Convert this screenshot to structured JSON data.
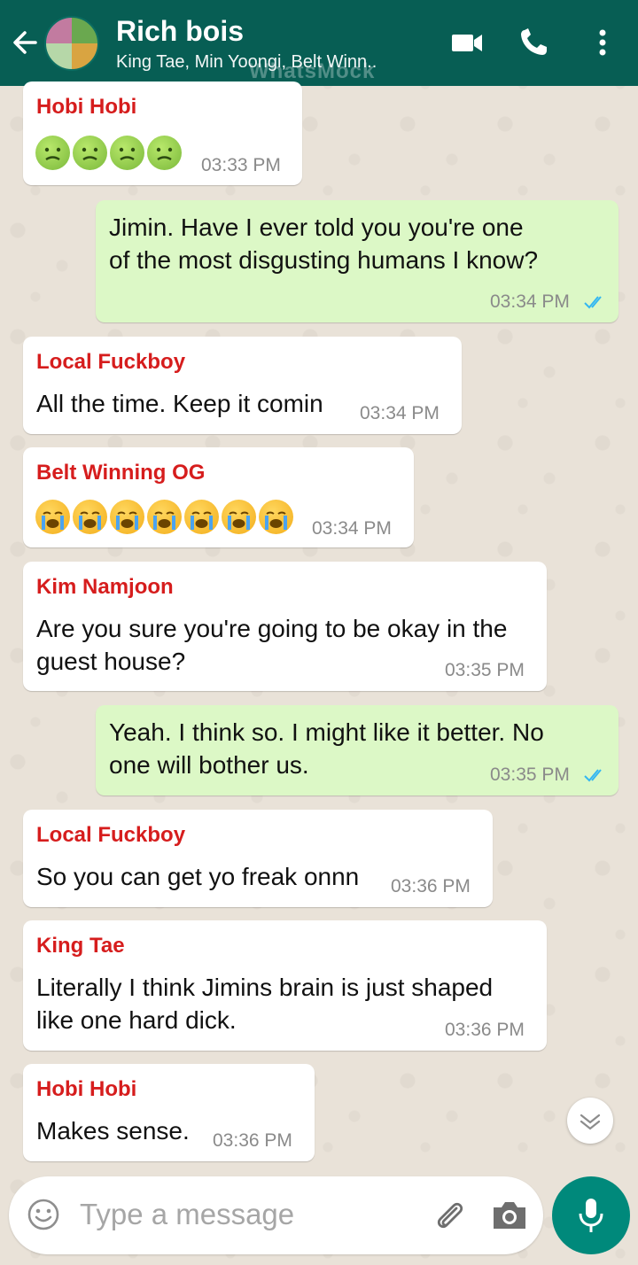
{
  "header": {
    "title": "Rich bois",
    "subtitle": "King Tae, Min Yoongi, Belt Winn..",
    "watermark": "WhatsMock"
  },
  "messages": [
    {
      "sender": "Hobi Hobi",
      "emoji": [
        "nauseated-face",
        "nauseated-face",
        "nauseated-face",
        "nauseated-face"
      ],
      "time": "03:33 PM",
      "direction": "in"
    },
    {
      "text_lines": [
        "Jimin. Have I ever told you you're one",
        "of the most disgusting humans I know?"
      ],
      "time": "03:34 PM",
      "direction": "out",
      "status": "read"
    },
    {
      "sender": "Local Fuckboy",
      "text": "All the time. Keep it comin",
      "time": "03:34 PM",
      "direction": "in"
    },
    {
      "sender": "Belt Winning OG",
      "emoji": [
        "loudly-crying-face",
        "loudly-crying-face",
        "loudly-crying-face",
        "loudly-crying-face",
        "loudly-crying-face",
        "loudly-crying-face",
        "loudly-crying-face"
      ],
      "time": "03:34 PM",
      "direction": "in"
    },
    {
      "sender": "Kim Namjoon",
      "text_lines": [
        "Are you sure you're going to be okay in the",
        "guest house?"
      ],
      "time": "03:35 PM",
      "direction": "in"
    },
    {
      "text_lines": [
        "Yeah. I think so. I might like it better. No",
        "one will bother us."
      ],
      "time": "03:35 PM",
      "direction": "out",
      "status": "read"
    },
    {
      "sender": "Local Fuckboy",
      "text": "So you can get yo freak onnn",
      "time": "03:36 PM",
      "direction": "in"
    },
    {
      "sender": "King Tae",
      "text_lines": [
        "Literally I think Jimins brain is just shaped",
        "like one hard dick."
      ],
      "time": "03:36 PM",
      "direction": "in"
    },
    {
      "sender": "Hobi Hobi",
      "text": "Makes sense.",
      "time": "03:36 PM",
      "direction": "in"
    }
  ],
  "input": {
    "placeholder": "Type a message"
  },
  "colors": {
    "header": "#075e54",
    "outgoing_bubble": "#dcf8c6",
    "incoming_bubble": "#ffffff",
    "sender_name": "#d61d1d",
    "read_ticks": "#34b7f1",
    "mic_button": "#00897b"
  },
  "icons": [
    "back-arrow-icon",
    "video-call-icon",
    "voice-call-icon",
    "more-options-icon",
    "emoji-icon",
    "attach-icon",
    "camera-icon",
    "mic-icon",
    "scroll-down-icon"
  ]
}
